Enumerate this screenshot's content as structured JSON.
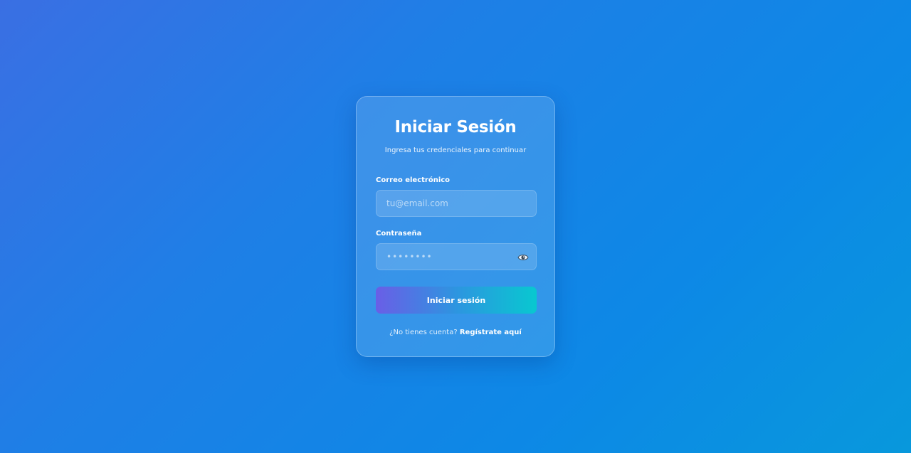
{
  "login": {
    "title": "Iniciar Sesión",
    "subtitle": "Ingresa tus credenciales para continuar",
    "email_label": "Correo electrónico",
    "email_placeholder": "tu@email.com",
    "password_label": "Contraseña",
    "password_placeholder": "••••••••",
    "eye_icon": "eye-icon",
    "submit_label": "Iniciar sesión",
    "footer_text": "¿No tienes cuenta?",
    "register_link": "Regístrate aquí"
  },
  "colors": {
    "background_start": "#3a6fe3",
    "background_end": "#0898dc",
    "button_start": "#6a5ee6",
    "button_end": "#08c8d0"
  }
}
